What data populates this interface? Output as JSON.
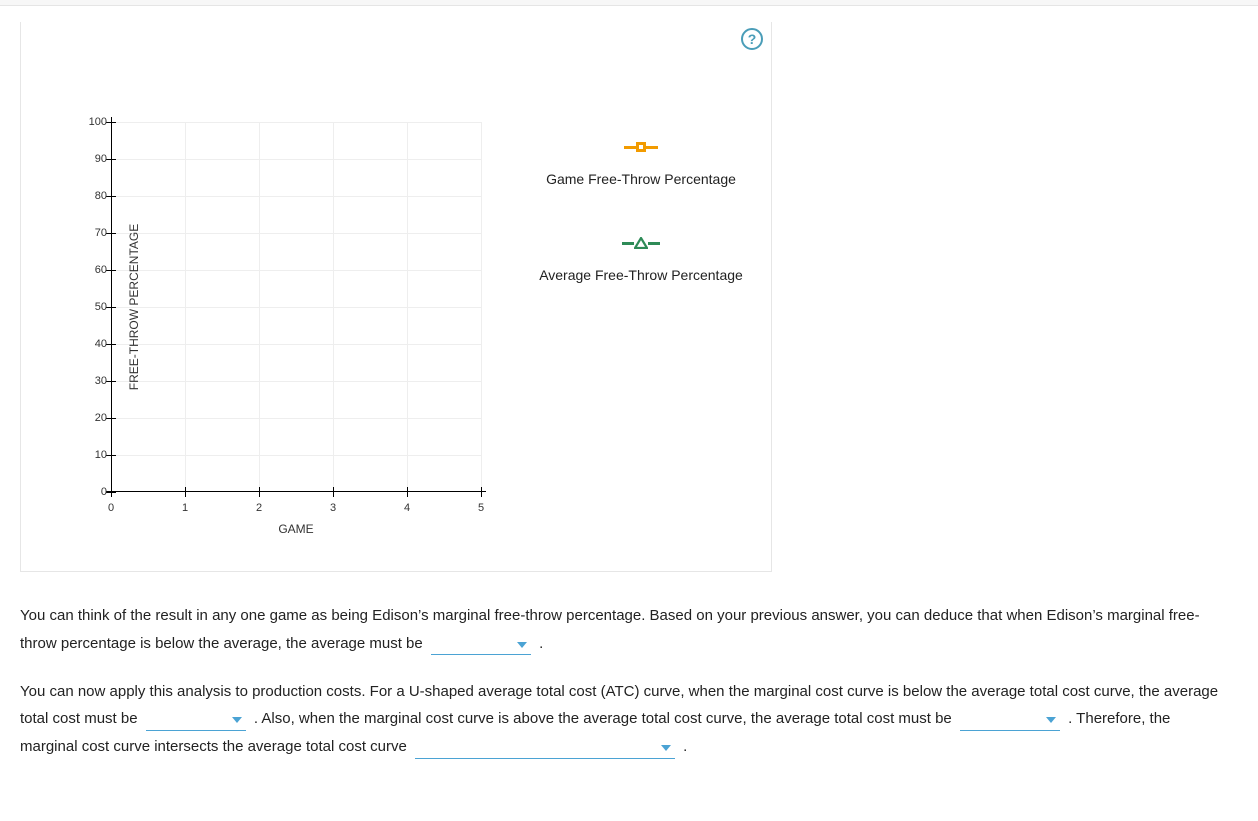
{
  "help": {
    "label": "?"
  },
  "chart_data": {
    "type": "line",
    "title": "",
    "xlabel": "GAME",
    "ylabel": "FREE-THROW PERCENTAGE",
    "xlim": [
      0,
      5
    ],
    "ylim": [
      0,
      100
    ],
    "x_ticks": [
      0,
      1,
      2,
      3,
      4,
      5
    ],
    "y_ticks": [
      0,
      10,
      20,
      30,
      40,
      50,
      60,
      70,
      80,
      90,
      100
    ],
    "categories": [],
    "series": [
      {
        "name": "Game Free-Throw Percentage",
        "marker": "square",
        "color": "#f29b00",
        "values": []
      },
      {
        "name": "Average Free-Throw Percentage",
        "marker": "triangle",
        "color": "#2e8b57",
        "values": []
      }
    ]
  },
  "text": {
    "p1a": "You can think of the result in any one game as being Edison’s marginal free-throw percentage. Based on your previous answer, you can deduce that when Edison’s marginal free-throw percentage is below the average, the average must be ",
    "p1b": " .",
    "p2a": "You can now apply this analysis to production costs. For a U-shaped average total cost (ATC) curve, when the marginal cost curve is below the average total cost curve, the average total cost must be ",
    "p2b": " . Also, when the marginal cost curve is above the average total cost curve, the average total cost must be ",
    "p2c": " . Therefore, the marginal cost curve intersects the average total cost curve ",
    "p2d": " ."
  }
}
